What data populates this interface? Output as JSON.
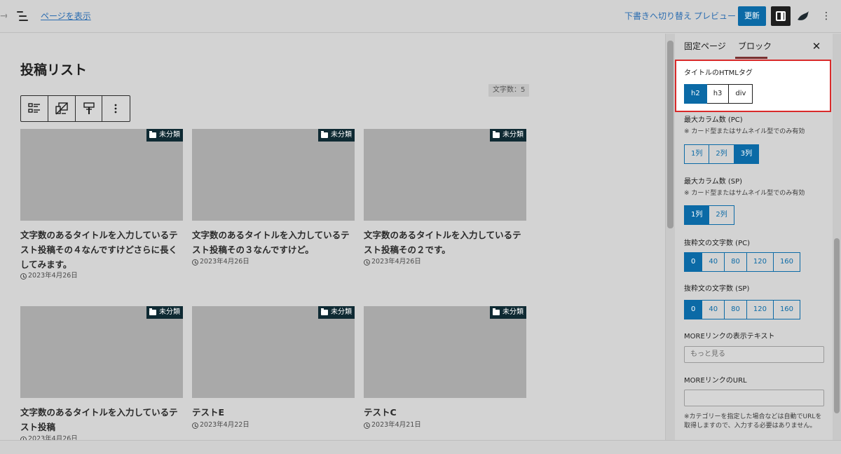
{
  "topbar": {
    "view_page": "ページを表示",
    "switch_draft": "下書きへ切り替え",
    "preview": "プレビュー",
    "update": "更新"
  },
  "editor": {
    "page_title": "投稿リスト",
    "char_count_badge": "文字数：5",
    "category_label": "未分類",
    "posts": [
      {
        "title": "文字数のあるタイトルを入力しているテスト投稿その４なんですけどさらに長くしてみます。",
        "date": "2023年4月26日"
      },
      {
        "title": "文字数のあるタイトルを入力しているテスト投稿その３なんですけど。",
        "date": "2023年4月26日"
      },
      {
        "title": "文字数のあるタイトルを入力しているテスト投稿その２です。",
        "date": "2023年4月26日"
      },
      {
        "title": "文字数のあるタイトルを入力しているテスト投稿",
        "date": "2023年4月26日"
      },
      {
        "title": "テストE",
        "date": "2023年4月22日"
      },
      {
        "title": "テストC",
        "date": "2023年4月21日"
      }
    ]
  },
  "sidebar": {
    "tabs": [
      "固定ページ",
      "ブロック"
    ],
    "active_tab": "ブロック",
    "title_tag": {
      "label": "タイトルのHTMLタグ",
      "options": [
        "h2",
        "h3",
        "div"
      ],
      "selected": "h2"
    },
    "max_col_pc": {
      "label": "最大カラム数 (PC)",
      "note": "※ カード型またはサムネイル型でのみ有効",
      "options": [
        "1列",
        "2列",
        "3列"
      ],
      "selected": "3列"
    },
    "max_col_sp": {
      "label": "最大カラム数 (SP)",
      "note": "※ カード型またはサムネイル型でのみ有効",
      "options": [
        "1列",
        "2列"
      ],
      "selected": "1列"
    },
    "excerpt_pc": {
      "label": "抜粋文の文字数 (PC)",
      "options": [
        "0",
        "40",
        "80",
        "120",
        "160"
      ],
      "selected": "0"
    },
    "excerpt_sp": {
      "label": "抜粋文の文字数 (SP)",
      "options": [
        "0",
        "40",
        "80",
        "120",
        "160"
      ],
      "selected": "0"
    },
    "more_text": {
      "label": "MOREリンクの表示テキスト",
      "value": "もっと見る"
    },
    "more_url": {
      "label": "MOREリンクのURL",
      "value": "",
      "note": "※カテゴリーを指定した場合などは自動でURLを取得しますので、入力する必要はありません。"
    }
  },
  "colors": {
    "accent": "#0b6aa6",
    "highlight_border": "#d92a2a",
    "category_bg": "#0f2a33"
  }
}
